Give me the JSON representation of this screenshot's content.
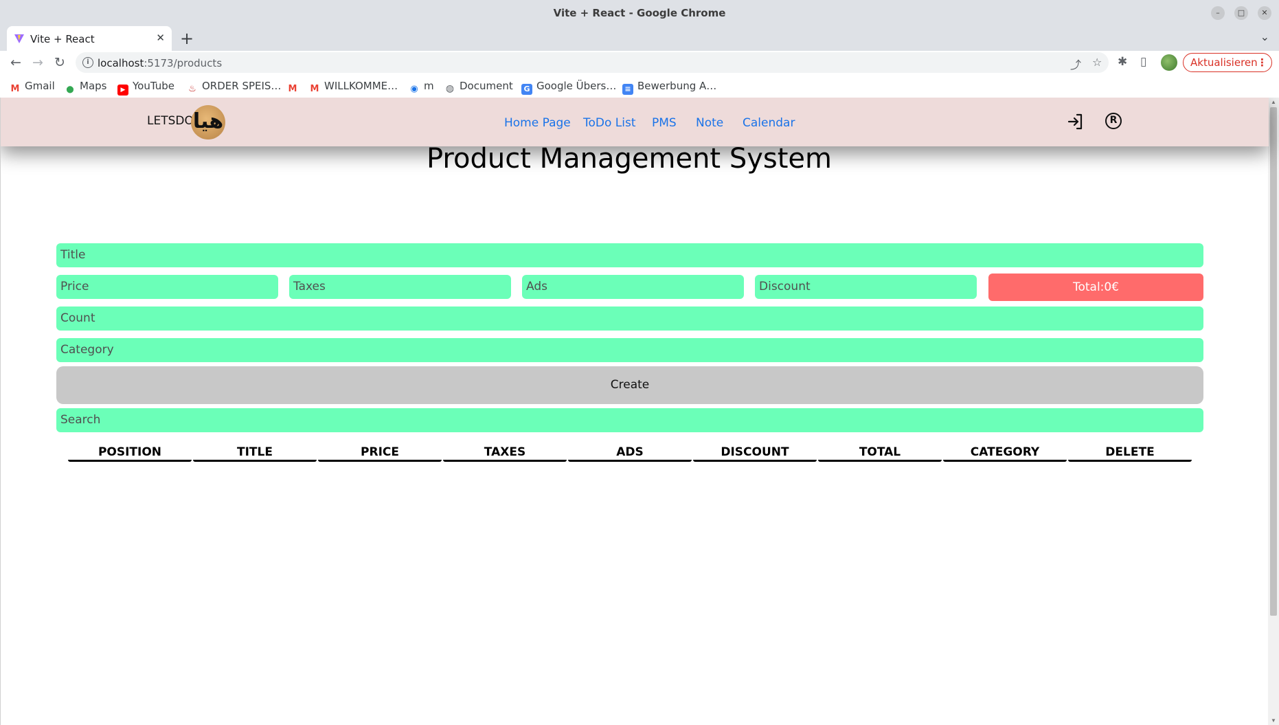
{
  "window": {
    "title": "Vite + React - Google Chrome",
    "minimize_glyph": "–",
    "maximize_glyph": "□",
    "close_glyph": "✕"
  },
  "tab": {
    "title": "Vite + React",
    "close_glyph": "✕",
    "new_tab_glyph": "+",
    "tab_list_glyph": "⌄"
  },
  "toolbar": {
    "back_glyph": "←",
    "forward_glyph": "→",
    "reload_glyph": "↻",
    "info_glyph": "i",
    "url_host": "localhost",
    "url_path": ":5173/products",
    "share_glyph": "⤴",
    "star_glyph": "☆",
    "extensions_glyph": "✱",
    "sidepanel_glyph": "▯",
    "update_label": "Aktualisieren",
    "menu_glyph": "⋮"
  },
  "bookmarks": [
    {
      "label": "Gmail",
      "icon": "gmail-icon",
      "badge": "M",
      "color": "#ea4335"
    },
    {
      "label": "Maps",
      "icon": "maps-icon",
      "badge": "⬤",
      "color": "#34a853"
    },
    {
      "label": "YouTube",
      "icon": "youtube-icon",
      "badge": "▶",
      "color": "#ff0000"
    },
    {
      "label": "ORDER SPEIS…",
      "icon": "order-icon",
      "badge": "♨",
      "color": "#c5221f"
    },
    {
      "label": "",
      "icon": "gmail-icon",
      "badge": "M",
      "color": "#ea4335"
    },
    {
      "label": "WILLKOMME…",
      "icon": "gmail-icon",
      "badge": "M",
      "color": "#ea4335"
    },
    {
      "label": "m",
      "icon": "m-circle-icon",
      "badge": "◉",
      "color": "#1a73e8"
    },
    {
      "label": "Document",
      "icon": "globe-icon",
      "badge": "◍",
      "color": "#5f6368"
    },
    {
      "label": "Google Übers…",
      "icon": "translate-icon",
      "badge": "G",
      "color": "#4285f4"
    },
    {
      "label": "Bewerbung A…",
      "icon": "docs-icon",
      "badge": "≡",
      "color": "#4285f4"
    }
  ],
  "navbar": {
    "brand": "LETSDO",
    "logo_text": "هيا",
    "links": [
      "Home Page",
      "ToDo List",
      "PMS",
      "Note",
      "Calendar"
    ],
    "register_glyph": "R"
  },
  "page": {
    "title": "Product Management System"
  },
  "form": {
    "title_placeholder": "Title",
    "price_placeholder": "Price",
    "taxes_placeholder": "Taxes",
    "ads_placeholder": "Ads",
    "discount_placeholder": "Discount",
    "total_label": "Total:0€",
    "count_placeholder": "Count",
    "category_placeholder": "Category",
    "create_label": "Create",
    "search_placeholder": "Search"
  },
  "table": {
    "headers": [
      "POSITION",
      "TITLE",
      "PRICE",
      "TAXES",
      "ADS",
      "DISCOUNT",
      "TOTAL",
      "CATEGORY",
      "DELETE"
    ]
  },
  "colors": {
    "navbar_bg": "#eedbda",
    "field_bg": "#6bffb8",
    "total_bg": "#ff6b6b",
    "create_bg": "#c8c8c8",
    "link": "#1a73e8"
  }
}
